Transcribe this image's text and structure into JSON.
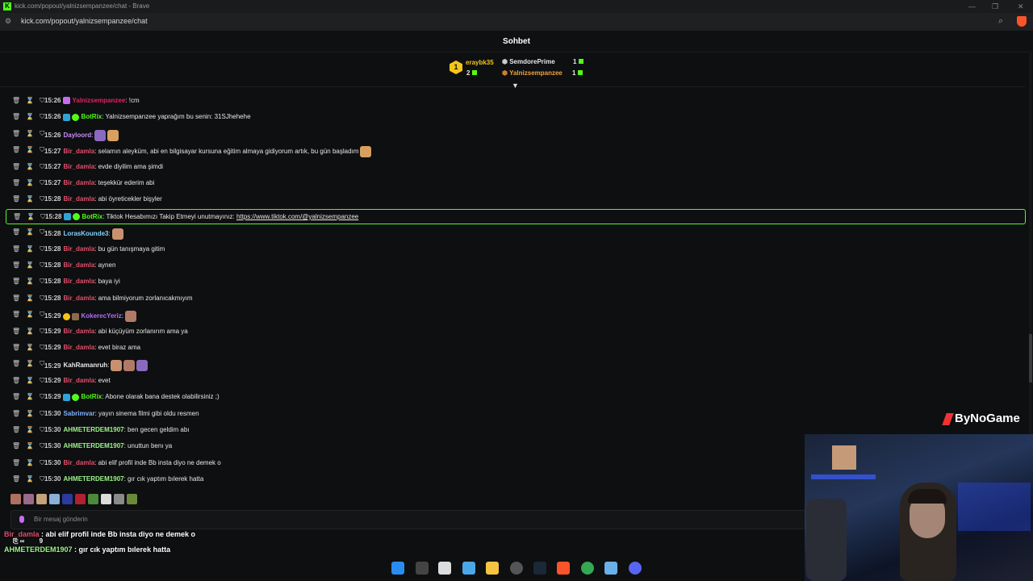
{
  "browser": {
    "window_title": "kick.com/popout/yalnizsempanzee/chat - Brave",
    "url": "kick.com/popout/yalnizsempanzee/chat"
  },
  "chat": {
    "title": "Sohbet",
    "leaderboard": {
      "first": {
        "rank": "1",
        "name": "eraybk35",
        "count": "2"
      },
      "second": {
        "name": "SemdorePrime",
        "count": "1"
      },
      "third": {
        "name": "Yalnizsempanzee",
        "count": "1"
      }
    },
    "messages": [
      {
        "time": "15:26",
        "user": "Yalnizsempanzee",
        "color": "#e0245e",
        "text": ": !cm",
        "badges": [
          "mic"
        ]
      },
      {
        "time": "15:26",
        "user": "BotRix",
        "color": "#53fc18",
        "text": ": Yalnizsempanzee yaprağım bu senin: 31SJhehehe",
        "badges": [
          "bot",
          "verified"
        ]
      },
      {
        "time": "15:26",
        "user": "Dayloord",
        "color": "#c88cf5",
        "text": ":",
        "emotes": 2
      },
      {
        "time": "15:27",
        "user": "Bir_damla",
        "color": "#e0506e",
        "text": ": selamın aleyküm, abi en bilgisayar kursuna eğitim almaya gidiyorum artık, bu gün başladım",
        "emotes": 1
      },
      {
        "time": "15:27",
        "user": "Bir_damla",
        "color": "#e0506e",
        "text": ": evde diyilim ama şimdi"
      },
      {
        "time": "15:27",
        "user": "Bir_damla",
        "color": "#e0506e",
        "text": ": teşekkür ederim abi"
      },
      {
        "time": "15:28",
        "user": "Bir_damla",
        "color": "#e0506e",
        "text": ": abi öyreticekler bişyler"
      },
      {
        "time": "15:28",
        "user": "BotRix",
        "color": "#53fc18",
        "text": ": Tiktok Hesabımızı Takip Etmeyi unutmayınız: ",
        "link": "https://www.tiktok.com/@yalnizsempanzee",
        "badges": [
          "bot",
          "verified"
        ],
        "highlight": true
      },
      {
        "time": "15:28",
        "user": "LorasKounde3",
        "color": "#7fd4ff",
        "text": ":",
        "emotes": 1
      },
      {
        "time": "15:28",
        "user": "Bir_damla",
        "color": "#e0506e",
        "text": ": bu gün tanışmaya gitim"
      },
      {
        "time": "15:28",
        "user": "Bir_damla",
        "color": "#e0506e",
        "text": ": aynen"
      },
      {
        "time": "15:28",
        "user": "Bir_damla",
        "color": "#e0506e",
        "text": ": baya iyi"
      },
      {
        "time": "15:28",
        "user": "Bir_damla",
        "color": "#e0506e",
        "text": ": ama bilmiyorum zorlanıcakmıyım"
      },
      {
        "time": "15:29",
        "user": "KokerecYeriz",
        "color": "#b36bff",
        "text": ":",
        "badges": [
          "sub",
          "hat"
        ],
        "emotes": 1
      },
      {
        "time": "15:29",
        "user": "Bir_damla",
        "color": "#e0506e",
        "text": ": abi küçüyüm zorlanırım ama ya"
      },
      {
        "time": "15:29",
        "user": "Bir_damla",
        "color": "#e0506e",
        "text": ": evet biraz ama"
      },
      {
        "time": "15:29",
        "user": "KahRamanruh",
        "color": "#e8e8e8",
        "text": ":",
        "emotes": 3
      },
      {
        "time": "15:29",
        "user": "Bir_damla",
        "color": "#e0506e",
        "text": ": evet"
      },
      {
        "time": "15:29",
        "user": "BotRix",
        "color": "#53fc18",
        "text": ": Abone olarak bana destek olabilirsiniz ;)",
        "badges": [
          "bot",
          "verified"
        ]
      },
      {
        "time": "15:30",
        "user": "Sabrimvar",
        "color": "#7fb4ff",
        "text": ": yayın sinema filmi gibi oldu resmen"
      },
      {
        "time": "15:30",
        "user": "AHMETERDEM1907",
        "color": "#9df58c",
        "text": ": ben gecen geldim abı"
      },
      {
        "time": "15:30",
        "user": "AHMETERDEM1907",
        "color": "#9df58c",
        "text": ": unuttun benı ya"
      },
      {
        "time": "15:30",
        "user": "Bir_damla",
        "color": "#e0506e",
        "text": ": abi elif profil inde Bb insta diyo ne demek o"
      },
      {
        "time": "15:30",
        "user": "AHMETERDEM1907",
        "color": "#9df58c",
        "text": ": gır cık yaptım bılerek hatta"
      }
    ],
    "input_placeholder": "Bir mesaj gönderin"
  },
  "overlay": {
    "line1_user": "Bir_damla",
    "line1_text": " : abi elif profil inde Bb insta diyo ne demek o",
    "line1_counts": "∞",
    "line1_count2": "9",
    "line2_user": "AHMETERDEM1907",
    "line2_text": " : gır cık yaptım bılerek hatta",
    "brand": "ByNoGame"
  }
}
